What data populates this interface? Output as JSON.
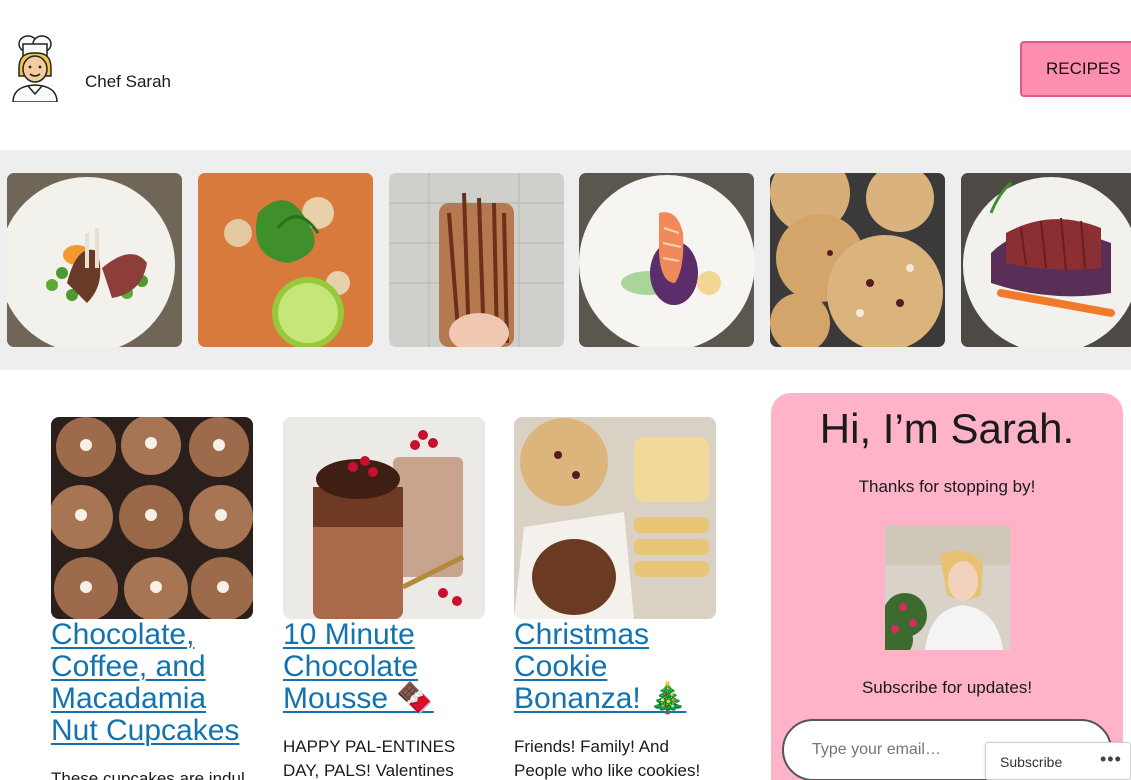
{
  "header": {
    "site_title": "Chef Sarah",
    "nav_recipes": "RECIPES",
    "logo_icon": "chef-icon"
  },
  "gallery": {
    "items": [
      {
        "name": "rack-of-lamb"
      },
      {
        "name": "curry-soup"
      },
      {
        "name": "jar-of-sticks"
      },
      {
        "name": "salmon-plate"
      },
      {
        "name": "cookies"
      },
      {
        "name": "steak-plate"
      }
    ]
  },
  "posts": [
    {
      "title": "Chocolate, Coffee, and Macadamia Nut Cupcakes",
      "excerpt": "These cupcakes are indul"
    },
    {
      "title": "10 Minute Chocolate Mousse 🍫",
      "excerpt": "HAPPY PAL-ENTINES DAY, PALS! Valentines"
    },
    {
      "title": "Christmas Cookie Bonanza! 🎄",
      "excerpt": "Friends! Family! And People who like cookies!"
    }
  ],
  "sidebar": {
    "greeting": "Hi, I’m Sarah.",
    "thanks": "Thanks for stopping by!",
    "subscribe_heading": "Subscribe for updates!",
    "email_placeholder": "Type your email…"
  },
  "floating_bar": {
    "subscribe_label": "Subscribe",
    "more_label": "•••"
  },
  "colors": {
    "accent_pink": "#ff8fb1",
    "sidebar_pink": "#ffb3c9",
    "link_blue": "#1273b0",
    "gallery_bg": "#eeeeee"
  }
}
